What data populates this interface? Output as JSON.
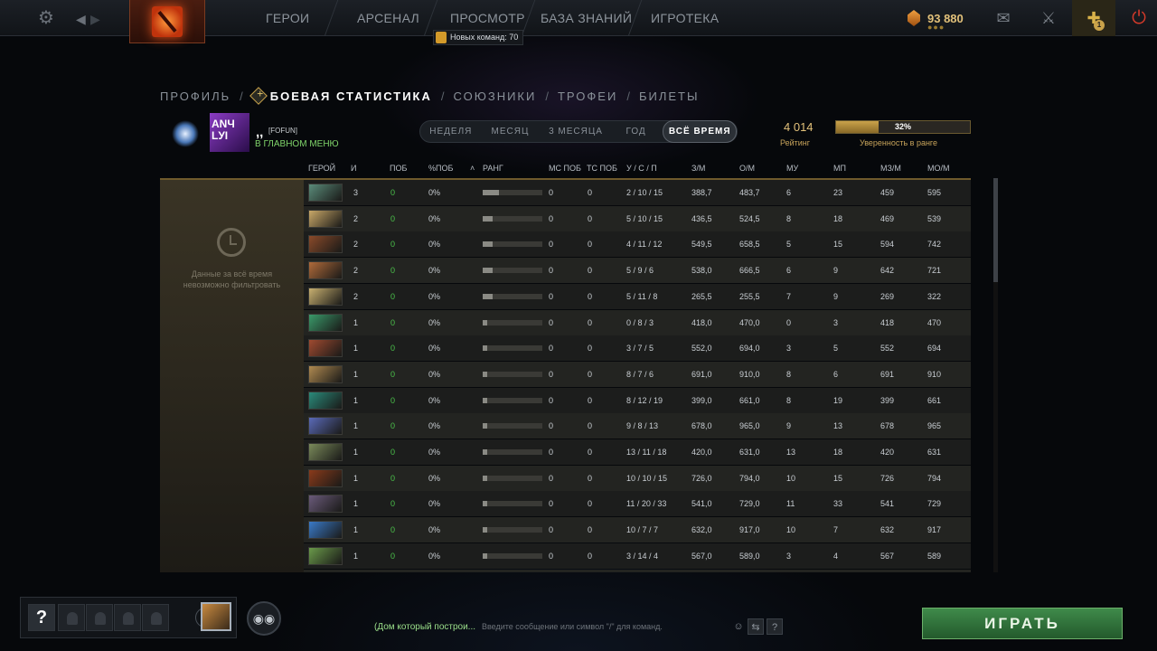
{
  "topbar": {
    "nav": [
      "ГЕРОИ",
      "АРСЕНАЛ",
      "ПРОСМОТР",
      "БАЗА ЗНАНИЙ",
      "ИГРОТЕКА"
    ],
    "currency": "93 880",
    "notice": "Новых команд: 70",
    "badge_count": "1"
  },
  "subnav": {
    "items": [
      "ПРОФИЛЬ",
      "БОЕВАЯ СТАТИСТИКА",
      "СОЮЗНИКИ",
      "ТРОФЕИ",
      "БИЛЕТЫ"
    ],
    "active_index": 1
  },
  "profile": {
    "name": ",,",
    "tag": "[FOFUN]",
    "status": "В ГЛАВНОМ МЕНЮ",
    "avatar_text": "ANЧ LУI",
    "rating": "4 014",
    "rating_label": "Рейтинг",
    "confidence": "32%",
    "confidence_value": 0.32,
    "confidence_label": "Уверенность в ранге"
  },
  "ranges": {
    "items": [
      "НЕДЕЛЯ",
      "МЕСЯЦ",
      "3 МЕСЯЦА",
      "ГОД",
      "ВСЁ ВРЕМЯ"
    ],
    "active_index": 4
  },
  "filter_notice": "Данные за всё время невозможно фильтровать",
  "table": {
    "headers": [
      "ГЕРОЙ",
      "И",
      "ПОБ",
      "%ПОБ",
      "РАНГ",
      "МС ПОБ",
      "ТС ПОБ",
      "У / С / П",
      "З/М",
      "О/М",
      "МУ",
      "МП",
      "МЗ/М",
      "МО/М"
    ],
    "rows": [
      {
        "i": "3",
        "pob": "0",
        "pct": "0%",
        "rank": 0.28,
        "ms": "0",
        "ts": "0",
        "kda": "2 / 10 / 15",
        "zm": "388,7",
        "om": "483,7",
        "mu": "6",
        "mp": "23",
        "mzm": "459",
        "mom": "595",
        "color": "#5a8c7a"
      },
      {
        "i": "2",
        "pob": "0",
        "pct": "0%",
        "rank": 0.17,
        "ms": "0",
        "ts": "0",
        "kda": "5 / 10 / 15",
        "zm": "436,5",
        "om": "524,5",
        "mu": "8",
        "mp": "18",
        "mzm": "469",
        "mom": "539",
        "color": "#c9a868"
      },
      {
        "i": "2",
        "pob": "0",
        "pct": "0%",
        "rank": 0.17,
        "ms": "0",
        "ts": "0",
        "kda": "4 / 11 / 12",
        "zm": "549,5",
        "om": "658,5",
        "mu": "5",
        "mp": "15",
        "mzm": "594",
        "mom": "742",
        "color": "#8a4a2a"
      },
      {
        "i": "2",
        "pob": "0",
        "pct": "0%",
        "rank": 0.17,
        "ms": "0",
        "ts": "0",
        "kda": "5 / 9 / 6",
        "zm": "538,0",
        "om": "666,5",
        "mu": "6",
        "mp": "9",
        "mzm": "642",
        "mom": "721",
        "color": "#b06a3a"
      },
      {
        "i": "2",
        "pob": "0",
        "pct": "0%",
        "rank": 0.17,
        "ms": "0",
        "ts": "0",
        "kda": "5 / 11 / 8",
        "zm": "265,5",
        "om": "255,5",
        "mu": "7",
        "mp": "9",
        "mzm": "269",
        "mom": "322",
        "color": "#c8b070"
      },
      {
        "i": "1",
        "pob": "0",
        "pct": "0%",
        "rank": 0.08,
        "ms": "0",
        "ts": "0",
        "kda": "0 / 8 / 3",
        "zm": "418,0",
        "om": "470,0",
        "mu": "0",
        "mp": "3",
        "mzm": "418",
        "mom": "470",
        "color": "#3a9a6a"
      },
      {
        "i": "1",
        "pob": "0",
        "pct": "0%",
        "rank": 0.08,
        "ms": "0",
        "ts": "0",
        "kda": "3 / 7 / 5",
        "zm": "552,0",
        "om": "694,0",
        "mu": "3",
        "mp": "5",
        "mzm": "552",
        "mom": "694",
        "color": "#a04a30"
      },
      {
        "i": "1",
        "pob": "0",
        "pct": "0%",
        "rank": 0.08,
        "ms": "0",
        "ts": "0",
        "kda": "8 / 7 / 6",
        "zm": "691,0",
        "om": "910,0",
        "mu": "8",
        "mp": "6",
        "mzm": "691",
        "mom": "910",
        "color": "#b08a50"
      },
      {
        "i": "1",
        "pob": "0",
        "pct": "0%",
        "rank": 0.08,
        "ms": "0",
        "ts": "0",
        "kda": "8 / 12 / 19",
        "zm": "399,0",
        "om": "661,0",
        "mu": "8",
        "mp": "19",
        "mzm": "399",
        "mom": "661",
        "color": "#2a8a7a"
      },
      {
        "i": "1",
        "pob": "0",
        "pct": "0%",
        "rank": 0.08,
        "ms": "0",
        "ts": "0",
        "kda": "9 / 8 / 13",
        "zm": "678,0",
        "om": "965,0",
        "mu": "9",
        "mp": "13",
        "mzm": "678",
        "mom": "965",
        "color": "#5a6ab8"
      },
      {
        "i": "1",
        "pob": "0",
        "pct": "0%",
        "rank": 0.08,
        "ms": "0",
        "ts": "0",
        "kda": "13 / 11 / 18",
        "zm": "420,0",
        "om": "631,0",
        "mu": "13",
        "mp": "18",
        "mzm": "420",
        "mom": "631",
        "color": "#7a8a5a"
      },
      {
        "i": "1",
        "pob": "0",
        "pct": "0%",
        "rank": 0.08,
        "ms": "0",
        "ts": "0",
        "kda": "10 / 10 / 15",
        "zm": "726,0",
        "om": "794,0",
        "mu": "10",
        "mp": "15",
        "mzm": "726",
        "mom": "794",
        "color": "#8a3a1a"
      },
      {
        "i": "1",
        "pob": "0",
        "pct": "0%",
        "rank": 0.08,
        "ms": "0",
        "ts": "0",
        "kda": "11 / 20 / 33",
        "zm": "541,0",
        "om": "729,0",
        "mu": "11",
        "mp": "33",
        "mzm": "541",
        "mom": "729",
        "color": "#6a5a7a"
      },
      {
        "i": "1",
        "pob": "0",
        "pct": "0%",
        "rank": 0.08,
        "ms": "0",
        "ts": "0",
        "kda": "10 / 7 / 7",
        "zm": "632,0",
        "om": "917,0",
        "mu": "10",
        "mp": "7",
        "mzm": "632",
        "mom": "917",
        "color": "#3a7ac8"
      },
      {
        "i": "1",
        "pob": "0",
        "pct": "0%",
        "rank": 0.08,
        "ms": "0",
        "ts": "0",
        "kda": "3 / 14 / 4",
        "zm": "567,0",
        "om": "589,0",
        "mu": "3",
        "mp": "4",
        "mzm": "567",
        "mom": "589",
        "color": "#6a9a4a"
      }
    ]
  },
  "bottom": {
    "question": "?",
    "chat_channel": "(Дом который построи...",
    "chat_placeholder": "Введите сообщение или символ \"/\" для команд.",
    "help": "?",
    "play": "ИГРАТЬ"
  }
}
